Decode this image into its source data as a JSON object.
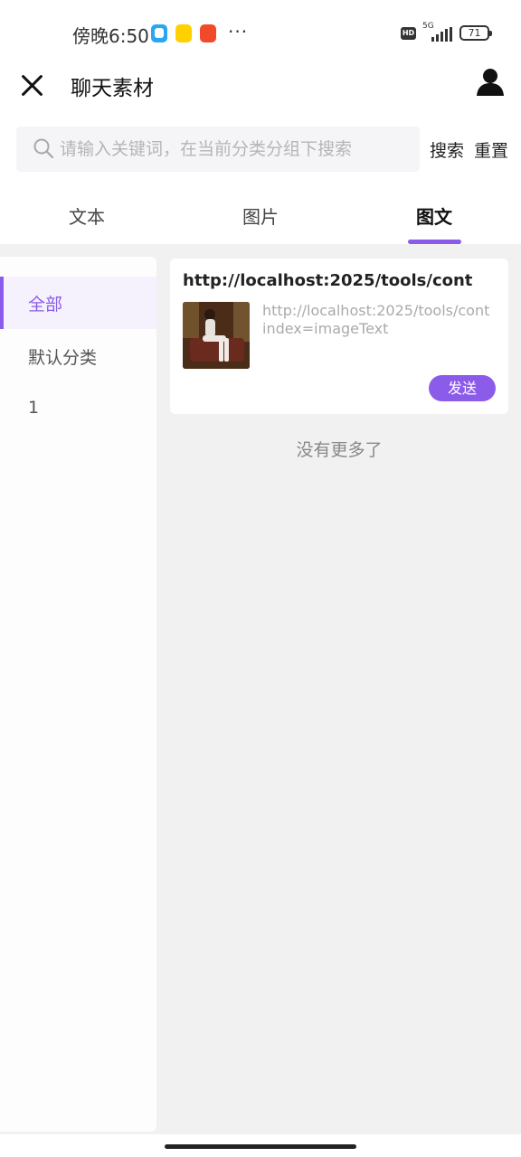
{
  "status_bar": {
    "time": "傍晚6:50",
    "dots": "···",
    "hd": "HD",
    "network": "5G",
    "battery": "71"
  },
  "header": {
    "title": "聊天素材"
  },
  "search": {
    "placeholder": "请输入关键词，在当前分类分组下搜索",
    "value": "",
    "search_label": "搜索",
    "reset_label": "重置"
  },
  "tabs": [
    {
      "label": "文本",
      "active": false
    },
    {
      "label": "图片",
      "active": false
    },
    {
      "label": "图文",
      "active": true
    }
  ],
  "sidebar": {
    "items": [
      {
        "label": "全部",
        "active": true
      },
      {
        "label": "默认分类",
        "active": false
      },
      {
        "label": "1",
        "active": false
      }
    ]
  },
  "materials": [
    {
      "title": "http://localhost:2025/tools/cont",
      "desc_line1": "http://localhost:2025/tools/cont",
      "desc_line2": "index=imageText",
      "send_label": "发送"
    }
  ],
  "footer": {
    "no_more": "没有更多了"
  },
  "colors": {
    "accent": "#8b5ce9",
    "background": "#f1f1f1"
  }
}
